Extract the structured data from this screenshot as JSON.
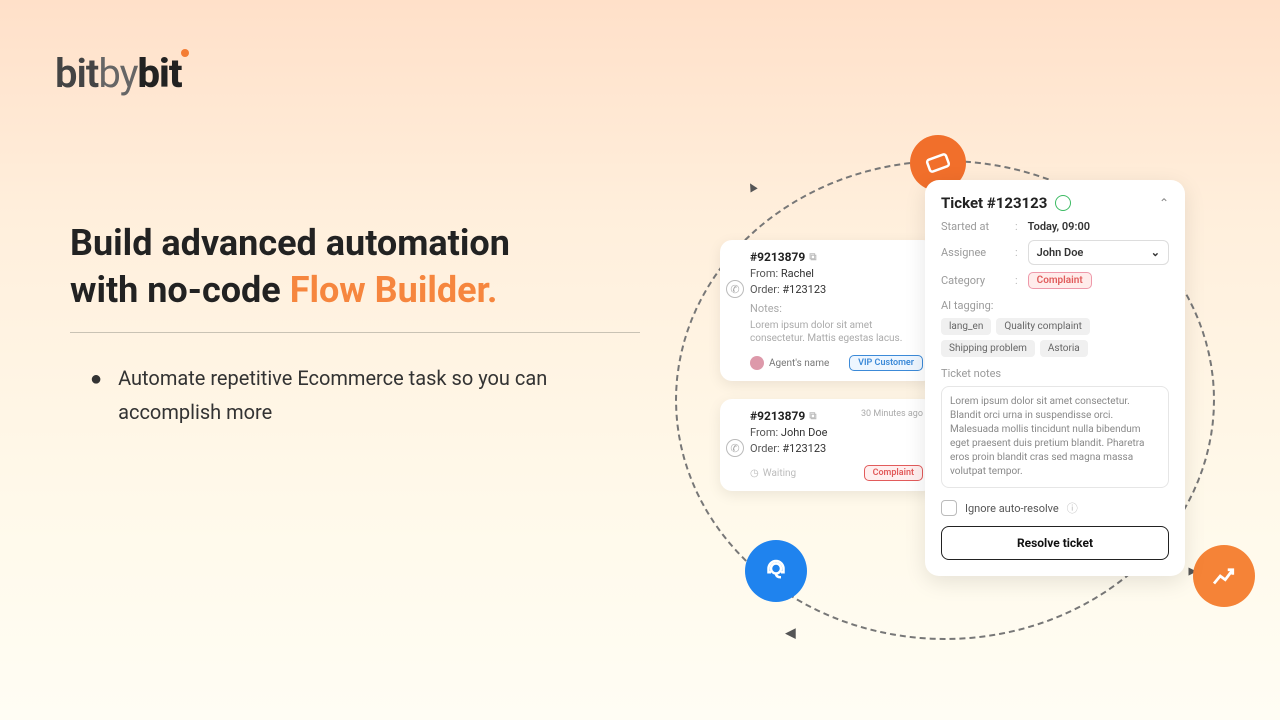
{
  "logo": {
    "p1": "bit",
    "p2": "by",
    "p3": "bit"
  },
  "headline": {
    "line1": "Build advanced automation",
    "line2a": "with no-code ",
    "line2b": "Flow Builder."
  },
  "bullet": "Automate repetitive Ecommerce task so you can accomplish more",
  "chat1": {
    "id": "#9213879",
    "from_lbl": "From:",
    "from": "Rachel",
    "order_lbl": "Order:",
    "order": "#123123",
    "notes_lbl": "Notes:",
    "notes": "Lorem ipsum dolor sit amet consectetur. Mattis egestas lacus.",
    "agent": "Agent's name",
    "badge": "VIP Customer"
  },
  "chat2": {
    "id": "#9213879",
    "time": "30 Minutes ago",
    "from_lbl": "From:",
    "from": "John Doe",
    "order_lbl": "Order:",
    "order": "#123123",
    "status": "Waiting",
    "badge": "Complaint"
  },
  "ticket": {
    "title": "Ticket #123123",
    "started_lbl": "Started at",
    "started": "Today, 09:00",
    "assignee_lbl": "Assignee",
    "assignee": "John Doe",
    "category_lbl": "Category",
    "category": "Complaint",
    "ai_tag_lbl": "AI tagging:",
    "tags": [
      "lang_en",
      "Quality complaint",
      "Shipping problem",
      "Astoria"
    ],
    "notes_lbl": "Ticket notes",
    "notes": "Lorem ipsum dolor sit amet consectetur. Blandit orci urna in suspendisse orci. Malesuada mollis tincidunt nulla bibendum eget praesent duis pretium blandit. Pharetra eros proin blandit cras sed magna massa volutpat tempor.",
    "ignore": "Ignore auto-resolve",
    "resolve": "Resolve ticket"
  }
}
